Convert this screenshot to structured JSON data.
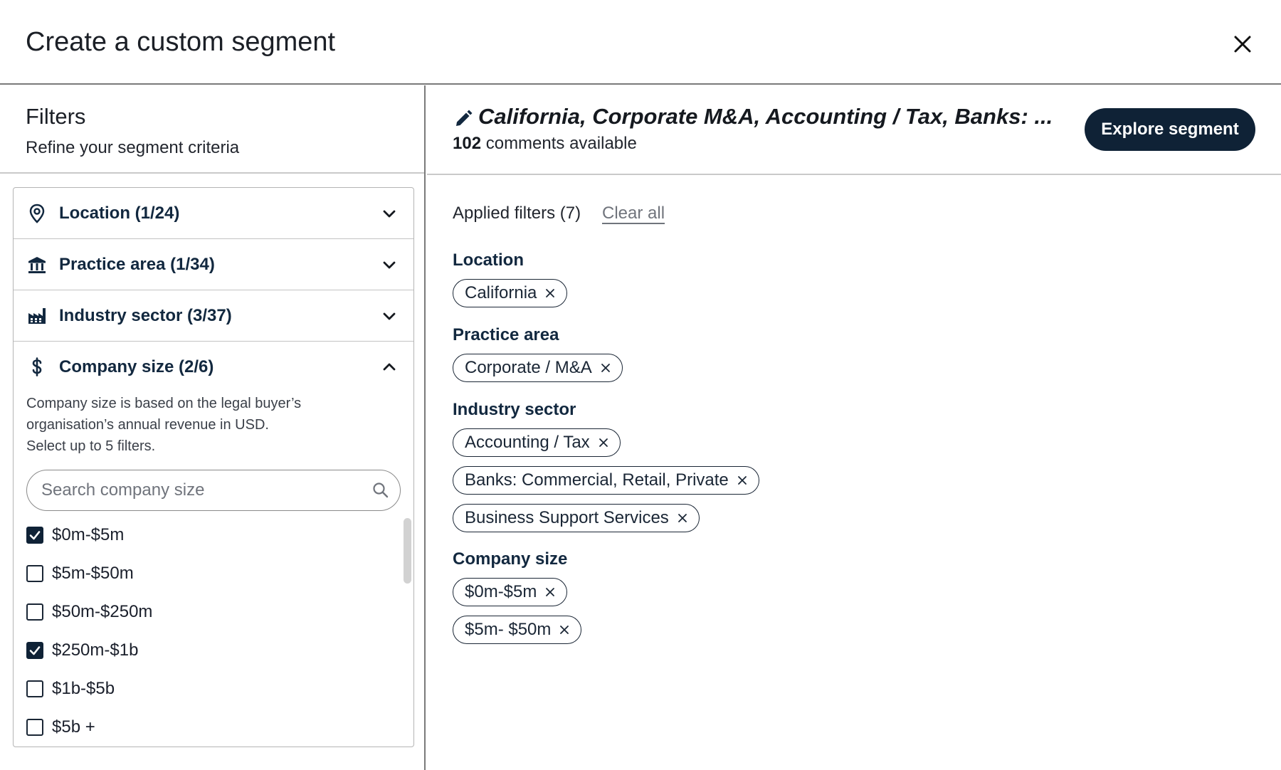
{
  "header": {
    "title": "Create a custom segment"
  },
  "filters": {
    "title": "Filters",
    "subtitle": "Refine your segment criteria",
    "sections": [
      {
        "label": "Location (1/24)",
        "icon": "location-pin-icon"
      },
      {
        "label": "Practice area (1/34)",
        "icon": "bank-building-icon"
      },
      {
        "label": "Industry sector (3/37)",
        "icon": "factory-icon"
      },
      {
        "label": "Company size (2/6)",
        "icon": "dollar-icon"
      }
    ],
    "company_size": {
      "description_lines": [
        "Company size is based on the legal buyer’s",
        "organisation’s annual revenue in USD.",
        "Select up to 5 filters."
      ],
      "search_placeholder": "Search company size",
      "options": [
        {
          "label": "$0m-$5m",
          "checked": true
        },
        {
          "label": "$5m-$50m",
          "checked": false
        },
        {
          "label": "$50m-$250m",
          "checked": false
        },
        {
          "label": "$250m-$1b",
          "checked": true
        },
        {
          "label": "$1b-$5b",
          "checked": false
        },
        {
          "label": "$5b +",
          "checked": false
        }
      ]
    }
  },
  "segment": {
    "title": "California, Corporate M&A, Accounting / Tax, Banks: ...",
    "count": "102",
    "count_suffix": "comments available",
    "explore_label": "Explore segment"
  },
  "applied": {
    "label": "Applied filters (7)",
    "clear_label": "Clear all",
    "groups": [
      {
        "title": "Location",
        "chips": [
          "California"
        ]
      },
      {
        "title": "Practice area",
        "chips": [
          "Corporate / M&A"
        ]
      },
      {
        "title": "Industry sector",
        "chips": [
          "Accounting / Tax",
          "Banks: Commercial, Retail, Private",
          "Business Support Services"
        ]
      },
      {
        "title": "Company size",
        "chips": [
          "$0m-$5m",
          "$5m- $50m"
        ]
      }
    ]
  },
  "colors": {
    "primary": "#0f2236",
    "heading": "#12283f",
    "muted": "#70747c"
  }
}
